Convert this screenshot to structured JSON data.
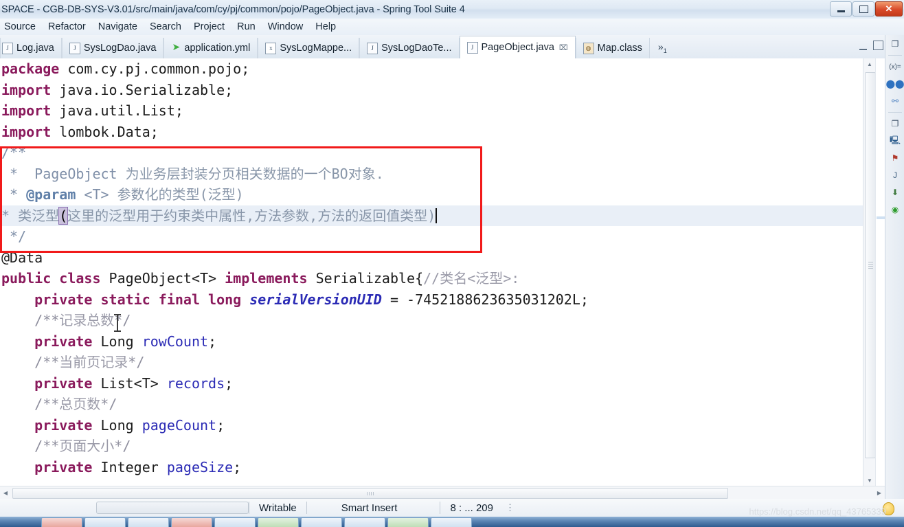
{
  "window": {
    "title": "SPACE - CGB-DB-SYS-V3.01/src/main/java/com/cy/pj/common/pojo/PageObject.java - Spring Tool Suite 4",
    "minimize_label": "Minimize",
    "maximize_label": "Restore",
    "close_label": "Close"
  },
  "menubar": {
    "items": [
      {
        "label": "Source"
      },
      {
        "label": "Refactor"
      },
      {
        "label": "Navigate"
      },
      {
        "label": "Search"
      },
      {
        "label": "Project"
      },
      {
        "label": "Run"
      },
      {
        "label": "Window"
      },
      {
        "label": "Help"
      }
    ]
  },
  "tabs": [
    {
      "label": "Log.java",
      "icon": "java-file-icon",
      "active": false,
      "closable": false
    },
    {
      "label": "SysLogDao.java",
      "icon": "java-file-icon",
      "active": false,
      "closable": false
    },
    {
      "label": "application.yml",
      "icon": "yml-file-icon",
      "active": false,
      "closable": false
    },
    {
      "label": "SysLogMappe...",
      "icon": "xml-file-icon",
      "active": false,
      "closable": false
    },
    {
      "label": "SysLogDaoTe...",
      "icon": "java-file-icon",
      "active": false,
      "closable": false
    },
    {
      "label": "PageObject.java",
      "icon": "java-file-icon",
      "active": true,
      "closable": true,
      "close_glyph": "⌧"
    },
    {
      "label": "Map.class",
      "icon": "class-file-icon",
      "active": false,
      "closable": false
    }
  ],
  "tabs_overflow": {
    "glyph": "»",
    "count": "1"
  },
  "editor": {
    "filename": "PageObject.java",
    "lines": [
      {
        "id": "l1",
        "segs": [
          {
            "t": "package",
            "c": "kw"
          },
          {
            "t": " com.cy.pj.common.pojo;",
            "c": "plain"
          }
        ]
      },
      {
        "id": "l2",
        "segs": [
          {
            "t": "import",
            "c": "kw"
          },
          {
            "t": " java.io.Serializable;",
            "c": "plain"
          }
        ]
      },
      {
        "id": "l3",
        "segs": [
          {
            "t": "import",
            "c": "kw"
          },
          {
            "t": " java.util.List;",
            "c": "plain"
          }
        ]
      },
      {
        "id": "l4",
        "segs": [
          {
            "t": "import",
            "c": "kw"
          },
          {
            "t": " lombok.Data;",
            "c": "plain"
          }
        ]
      },
      {
        "id": "l5",
        "segs": [
          {
            "t": "/**",
            "c": "jdoc"
          }
        ]
      },
      {
        "id": "l6",
        "segs": [
          {
            "t": " *  PageObject ",
            "c": "jdoc"
          },
          {
            "t": "为业务层封装分页相关数据的一个BO对象.",
            "c": "jdoc-cn"
          }
        ]
      },
      {
        "id": "l7",
        "segs": [
          {
            "t": " * ",
            "c": "jdoc"
          },
          {
            "t": "@param",
            "c": "jdoc-tag"
          },
          {
            "t": " <T> ",
            "c": "jdoc"
          },
          {
            "t": "参数化的类型(泛型)",
            "c": "jdoc-cn"
          }
        ]
      },
      {
        "id": "l8",
        "highlight": true,
        "caret_end": true,
        "segs": [
          {
            "t": "* ",
            "c": "jdoc"
          },
          {
            "t": "类泛型",
            "c": "jdoc-cn"
          },
          {
            "t": "(",
            "c": "sel-char"
          },
          {
            "t": "这里的泛型用于约束类中属性,方法参数,方法的返回值类型)",
            "c": "jdoc-cn"
          }
        ]
      },
      {
        "id": "l9",
        "segs": [
          {
            "t": " */",
            "c": "jdoc"
          }
        ]
      },
      {
        "id": "l10",
        "segs": [
          {
            "t": "@Data",
            "c": "plain"
          }
        ]
      },
      {
        "id": "l11",
        "segs": [
          {
            "t": "public class",
            "c": "kw"
          },
          {
            "t": " PageObject<T> ",
            "c": "plain"
          },
          {
            "t": "implements",
            "c": "kw"
          },
          {
            "t": " Serializable{",
            "c": "plain"
          },
          {
            "t": "//类名<泛型>:",
            "c": "cmt-cn"
          }
        ]
      },
      {
        "id": "l12",
        "segs": [
          {
            "t": "    private static final long",
            "c": "kw"
          },
          {
            "t": " ",
            "c": "plain"
          },
          {
            "t": "serialVersionUID",
            "c": "static-field"
          },
          {
            "t": " = -7452188623635031202L;",
            "c": "plain"
          }
        ]
      },
      {
        "id": "l13",
        "segs": [
          {
            "t": "    /**",
            "c": "cmt"
          },
          {
            "t": "记录总数",
            "c": "cmt-cn"
          },
          {
            "t": "*/",
            "c": "cmt"
          }
        ]
      },
      {
        "id": "l14",
        "segs": [
          {
            "t": "    private",
            "c": "kw"
          },
          {
            "t": " Long ",
            "c": "plain"
          },
          {
            "t": "rowCount",
            "c": "field"
          },
          {
            "t": ";",
            "c": "plain"
          }
        ]
      },
      {
        "id": "l15",
        "segs": [
          {
            "t": "    /**",
            "c": "cmt"
          },
          {
            "t": "当前页记录",
            "c": "cmt-cn"
          },
          {
            "t": "*/",
            "c": "cmt"
          }
        ]
      },
      {
        "id": "l16",
        "segs": [
          {
            "t": "    private",
            "c": "kw"
          },
          {
            "t": " List<T> ",
            "c": "plain"
          },
          {
            "t": "records",
            "c": "field"
          },
          {
            "t": ";",
            "c": "plain"
          }
        ]
      },
      {
        "id": "l17",
        "segs": [
          {
            "t": "    /**",
            "c": "cmt"
          },
          {
            "t": "总页数",
            "c": "cmt-cn"
          },
          {
            "t": "*/",
            "c": "cmt"
          }
        ]
      },
      {
        "id": "l18",
        "segs": [
          {
            "t": "    private",
            "c": "kw"
          },
          {
            "t": " Long ",
            "c": "plain"
          },
          {
            "t": "pageCount",
            "c": "field"
          },
          {
            "t": ";",
            "c": "plain"
          }
        ]
      },
      {
        "id": "l19",
        "segs": [
          {
            "t": "    /**",
            "c": "cmt"
          },
          {
            "t": "页面大小",
            "c": "cmt-cn"
          },
          {
            "t": "*/",
            "c": "cmt"
          }
        ]
      },
      {
        "id": "l20",
        "segs": [
          {
            "t": "    private",
            "c": "kw"
          },
          {
            "t": " Integer ",
            "c": "plain"
          },
          {
            "t": "pageSize",
            "c": "field"
          },
          {
            "t": ";",
            "c": "plain"
          }
        ]
      }
    ],
    "annotation": {
      "shape": "rectangle",
      "color": "#f11a1a",
      "note": "highlight-box-around-javadoc"
    }
  },
  "statusbar": {
    "writable": "Writable",
    "insert_mode": "Smart Insert",
    "position": "8 : ... 209",
    "trailing_dots": "⋮"
  },
  "watermark": {
    "text": "https://blog.csdn.net/qq_43765339"
  },
  "rightbar": {
    "icons": [
      "restore-view-icon",
      "variables-icon",
      "breakpoints-icon",
      "outline-icon",
      "minimize-view-icon",
      "console-icon",
      "problems-icon",
      "javadoc-icon",
      "download-icon",
      "spring-boot-icon"
    ]
  },
  "colors": {
    "keyword": "#8a1a5c",
    "field": "#2b2bb5",
    "comment": "#8f8f9e",
    "javadoc": "#7f8fa8",
    "annotation_box": "#f11a1a",
    "selection": "#e9eff7"
  }
}
